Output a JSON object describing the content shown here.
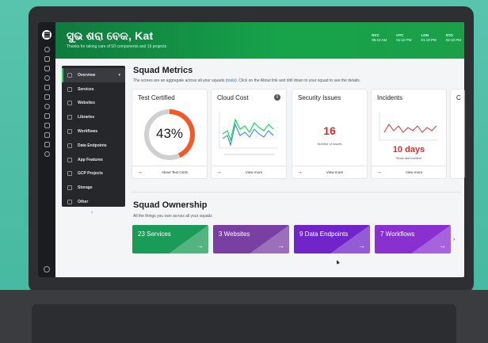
{
  "header": {
    "greeting": "ସୁଭ ଶରା ବେକ, Kat",
    "subtitle": "Thanks for taking care of 50 components and 19 projects",
    "clocks": [
      {
        "city": "NYC",
        "time": "08:10 AM"
      },
      {
        "city": "UTC",
        "time": "01:10 PM"
      },
      {
        "city": "LON",
        "time": "01:10 PM"
      },
      {
        "city": "STO",
        "time": "02:10 PM"
      }
    ]
  },
  "sidenav": {
    "items": [
      {
        "label": "Overview",
        "active": true
      },
      {
        "label": "Services"
      },
      {
        "label": "Websites"
      },
      {
        "label": "Libraries"
      },
      {
        "label": "Workflows"
      },
      {
        "label": "Data Endpoints"
      },
      {
        "label": "App Features"
      },
      {
        "label": "GCP Projects"
      },
      {
        "label": "Storage"
      },
      {
        "label": "Other"
      }
    ],
    "collapse": "‹"
  },
  "metrics": {
    "title": "Squad Metrics",
    "subtitle_pre": "The scores are an aggregate across all your squads (",
    "subtitle_link": "tools",
    "subtitle_post": "). Click on the About link and drill down to your squad to see the details.",
    "cards": {
      "test_certified": {
        "title": "Test Certified",
        "value": "43%",
        "percent": 43,
        "footer": "About Test Certs"
      },
      "cloud_cost": {
        "title": "Cloud Cost",
        "footer": "View more"
      },
      "security": {
        "title": "Security Issues",
        "value": "16",
        "caption": "Number of issues",
        "footer": "View more"
      },
      "incidents": {
        "title": "Incidents",
        "value": "10 days",
        "caption": "Since last incident",
        "footer": "View more"
      },
      "partial": {
        "title": "C"
      }
    }
  },
  "ownership": {
    "title": "Squad Ownership",
    "subtitle": "All the things you own across all your squads",
    "tiles": [
      {
        "label": "23 Services",
        "color": "#1a9b58"
      },
      {
        "label": "3 Websites",
        "color": "#7a3fa3"
      },
      {
        "label": "9 Data Endpoints",
        "color": "#7124c8"
      },
      {
        "label": "7 Workflows",
        "color": "#8a2fd0"
      }
    ]
  },
  "colors": {
    "accent": "#1ed760",
    "danger": "#d23030",
    "donut": "#f05a28"
  }
}
